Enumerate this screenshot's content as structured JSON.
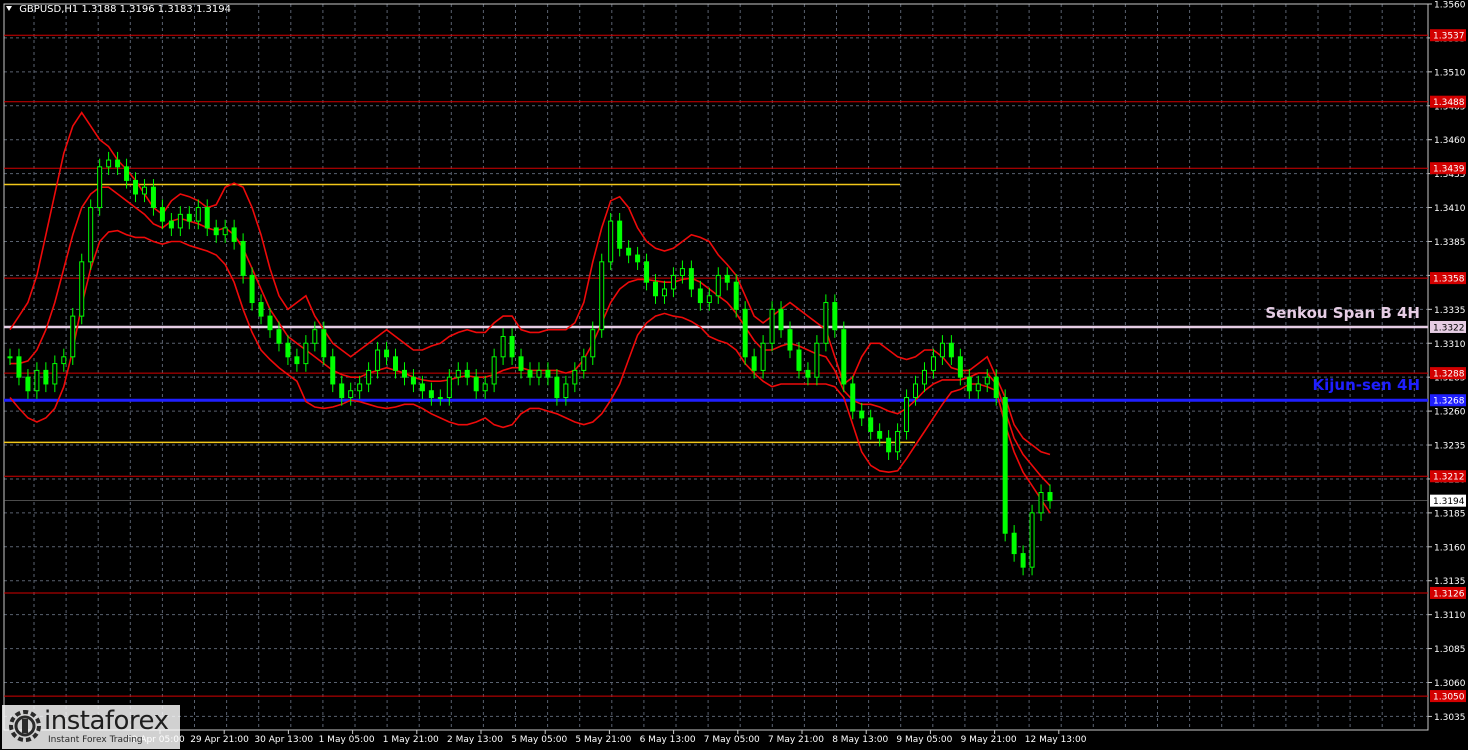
{
  "header": {
    "symbol": "GBPUSD,H1",
    "ohlc": "1.3188 1.3196 1.3183 1.3194"
  },
  "watermark": {
    "brand": "instaforex",
    "tagline": "Instant Forex Trading"
  },
  "colors": {
    "background": "#000000",
    "grid": "#5a6270",
    "axis": "#c8c8c8",
    "candle": "#00ff00",
    "bollinger": "#ee0a0a",
    "support_resistance": "#d30000",
    "senkou_span_b": "#e6cde4",
    "kijun_sen": "#1f1fff",
    "channel": "#f2c71a",
    "price_tag": "#ffffff"
  },
  "chart_data": {
    "type": "line",
    "instrument": "GBPUSD",
    "timeframe": "H1",
    "ylim": [
      1.3025,
      1.356
    ],
    "y_ticks": [
      "1.3560",
      "1.3535",
      "1.3510",
      "1.3485",
      "1.3460",
      "1.3435",
      "1.3410",
      "1.3385",
      "1.3360",
      "1.3335",
      "1.3310",
      "1.3285",
      "1.3260",
      "1.3235",
      "1.3210",
      "1.3185",
      "1.3160",
      "1.3135",
      "1.3110",
      "1.3085",
      "1.3060",
      "1.3035"
    ],
    "x_ticks": [
      "29 Apr 05:00",
      "29 Apr 21:00",
      "30 Apr 13:00",
      "1 May 05:00",
      "1 May 21:00",
      "2 May 13:00",
      "5 May 05:00",
      "5 May 21:00",
      "6 May 13:00",
      "7 May 05:00",
      "7 May 21:00",
      "8 May 13:00",
      "9 May 05:00",
      "9 May 21:00",
      "12 May 13:00"
    ],
    "current_price": "1.3194",
    "levels": [
      {
        "value": 1.3537,
        "label": "1.3537",
        "kind": "resistance"
      },
      {
        "value": 1.3488,
        "label": "1.3488",
        "kind": "resistance"
      },
      {
        "value": 1.3439,
        "label": "1.3439",
        "kind": "resistance"
      },
      {
        "value": 1.3358,
        "label": "1.3358",
        "kind": "resistance"
      },
      {
        "value": 1.3288,
        "label": "1.3288",
        "kind": "resistance"
      },
      {
        "value": 1.3212,
        "label": "1.3212",
        "kind": "support"
      },
      {
        "value": 1.3126,
        "label": "1.3126",
        "kind": "support"
      },
      {
        "value": 1.305,
        "label": "1.3050",
        "kind": "support"
      }
    ],
    "senkou_span_b": {
      "value": 1.3322,
      "label": "1.3322",
      "text": "Senkou Span B 4H"
    },
    "kijun_sen": {
      "value": 1.3268,
      "label": "1.3268",
      "text": "Kijun-sen 4H"
    },
    "channel": [
      {
        "from_idx": 0,
        "to_idx": 99,
        "value": 1.3427
      },
      {
        "from_idx": 0,
        "to_idx": 99,
        "value": 1.3237
      }
    ],
    "price_close": [
      1.33,
      1.3285,
      1.3275,
      1.329,
      1.328,
      1.3295,
      1.33,
      1.333,
      1.337,
      1.341,
      1.344,
      1.3445,
      1.344,
      1.343,
      1.342,
      1.3425,
      1.341,
      1.34,
      1.3395,
      1.3405,
      1.34,
      1.341,
      1.3395,
      1.339,
      1.3395,
      1.3385,
      1.336,
      1.334,
      1.333,
      1.332,
      1.331,
      1.33,
      1.3295,
      1.331,
      1.332,
      1.33,
      1.328,
      1.327,
      1.3275,
      1.328,
      1.329,
      1.3305,
      1.33,
      1.329,
      1.3285,
      1.328,
      1.3275,
      1.327,
      1.327,
      1.3285,
      1.329,
      1.3285,
      1.3275,
      1.328,
      1.33,
      1.3315,
      1.33,
      1.329,
      1.3285,
      1.329,
      1.3285,
      1.327,
      1.328,
      1.329,
      1.33,
      1.332,
      1.337,
      1.34,
      1.338,
      1.3375,
      1.337,
      1.3355,
      1.3345,
      1.335,
      1.336,
      1.3365,
      1.335,
      1.334,
      1.3345,
      1.336,
      1.3355,
      1.3335,
      1.33,
      1.329,
      1.331,
      1.3335,
      1.332,
      1.3305,
      1.329,
      1.3285,
      1.331,
      1.334,
      1.332,
      1.328,
      1.326,
      1.3255,
      1.3245,
      1.324,
      1.323,
      1.3245,
      1.327,
      1.328,
      1.329,
      1.33,
      1.331,
      1.33,
      1.3285,
      1.3275,
      1.328,
      1.3285,
      1.327,
      1.317,
      1.3155,
      1.3145,
      1.3185,
      1.32,
      1.3194
    ],
    "bb_upper": [
      1.332,
      1.333,
      1.334,
      1.336,
      1.339,
      1.342,
      1.345,
      1.347,
      1.348,
      1.347,
      1.346,
      1.3455,
      1.3445,
      1.3438,
      1.343,
      1.342,
      1.341,
      1.3405,
      1.3415,
      1.342,
      1.3418,
      1.3415,
      1.341,
      1.3412,
      1.3425,
      1.3428,
      1.3425,
      1.341,
      1.339,
      1.3365,
      1.3345,
      1.3335,
      1.334,
      1.3345,
      1.333,
      1.332,
      1.331,
      1.3305,
      1.33,
      1.3305,
      1.331,
      1.3315,
      1.332,
      1.3315,
      1.331,
      1.3305,
      1.3305,
      1.3308,
      1.331,
      1.3315,
      1.3318,
      1.332,
      1.3318,
      1.3318,
      1.3325,
      1.333,
      1.333,
      1.332,
      1.3318,
      1.3318,
      1.332,
      1.332,
      1.332,
      1.3325,
      1.334,
      1.337,
      1.3395,
      1.3415,
      1.3418,
      1.341,
      1.3395,
      1.3385,
      1.338,
      1.3378,
      1.338,
      1.3385,
      1.339,
      1.3388,
      1.3385,
      1.3375,
      1.3368,
      1.336,
      1.3345,
      1.333,
      1.3325,
      1.333,
      1.3335,
      1.334,
      1.3335,
      1.333,
      1.3325,
      1.332,
      1.33,
      1.328,
      1.3285,
      1.33,
      1.331,
      1.331,
      1.3305,
      1.33,
      1.3298,
      1.33,
      1.3305,
      1.3305,
      1.33,
      1.3292,
      1.329,
      1.329,
      1.3295,
      1.33,
      1.3285,
      1.327,
      1.325,
      1.324,
      1.3235,
      1.323,
      1.3228
    ],
    "bb_middle": [
      1.3295,
      1.3295,
      1.3297,
      1.3305,
      1.332,
      1.334,
      1.3365,
      1.339,
      1.341,
      1.342,
      1.3425,
      1.3425,
      1.342,
      1.3415,
      1.341,
      1.3405,
      1.3398,
      1.3395,
      1.34,
      1.3402,
      1.34,
      1.3398,
      1.3395,
      1.3393,
      1.3395,
      1.339,
      1.338,
      1.3365,
      1.335,
      1.3335,
      1.3325,
      1.3315,
      1.331,
      1.3305,
      1.33,
      1.3295,
      1.329,
      1.3287,
      1.3285,
      1.3285,
      1.3288,
      1.329,
      1.3292,
      1.329,
      1.3288,
      1.3285,
      1.3283,
      1.3282,
      1.3282,
      1.3283,
      1.3285,
      1.3286,
      1.3285,
      1.3285,
      1.3287,
      1.329,
      1.3292,
      1.3292,
      1.329,
      1.329,
      1.329,
      1.329,
      1.3288,
      1.329,
      1.3298,
      1.331,
      1.3325,
      1.334,
      1.335,
      1.3355,
      1.3357,
      1.3357,
      1.3356,
      1.3355,
      1.3355,
      1.3357,
      1.3358,
      1.3355,
      1.335,
      1.3345,
      1.334,
      1.3332,
      1.3322,
      1.3312,
      1.3305,
      1.3305,
      1.3308,
      1.331,
      1.3308,
      1.3305,
      1.3302,
      1.33,
      1.329,
      1.3275,
      1.3268,
      1.3265,
      1.3265,
      1.3263,
      1.326,
      1.3258,
      1.3262,
      1.3268,
      1.3275,
      1.328,
      1.3283,
      1.3283,
      1.3283,
      1.3285,
      1.3288,
      1.3288,
      1.328,
      1.326,
      1.324,
      1.3228,
      1.322,
      1.3212,
      1.3205
    ],
    "bb_lower": [
      1.327,
      1.3262,
      1.3255,
      1.3252,
      1.3255,
      1.3262,
      1.3278,
      1.3305,
      1.3338,
      1.3365,
      1.3385,
      1.3392,
      1.3393,
      1.339,
      1.3388,
      1.3388,
      1.3385,
      1.3383,
      1.3385,
      1.3385,
      1.3382,
      1.338,
      1.3378,
      1.3375,
      1.3368,
      1.3355,
      1.3335,
      1.3318,
      1.3305,
      1.3298,
      1.3292,
      1.3287,
      1.3282,
      1.3267,
      1.3263,
      1.3262,
      1.3263,
      1.3265,
      1.3268,
      1.3267,
      1.3265,
      1.3263,
      1.3262,
      1.3263,
      1.3265,
      1.3265,
      1.3262,
      1.3258,
      1.3255,
      1.3252,
      1.325,
      1.325,
      1.3252,
      1.3255,
      1.325,
      1.3248,
      1.325,
      1.3258,
      1.3262,
      1.3262,
      1.326,
      1.3258,
      1.3255,
      1.3252,
      1.325,
      1.3252,
      1.3258,
      1.3268,
      1.328,
      1.3298,
      1.3316,
      1.3325,
      1.333,
      1.3332,
      1.333,
      1.3329,
      1.3326,
      1.3322,
      1.3315,
      1.3312,
      1.331,
      1.3305,
      1.3295,
      1.3288,
      1.3282,
      1.3278,
      1.328,
      1.328,
      1.328,
      1.328,
      1.328,
      1.328,
      1.3278,
      1.327,
      1.325,
      1.323,
      1.322,
      1.3216,
      1.3215,
      1.3216,
      1.3225,
      1.3235,
      1.3245,
      1.3255,
      1.3265,
      1.3274,
      1.3276,
      1.328,
      1.328,
      1.3278,
      1.3275,
      1.325,
      1.323,
      1.3215,
      1.3205,
      1.3195,
      1.3185
    ]
  }
}
